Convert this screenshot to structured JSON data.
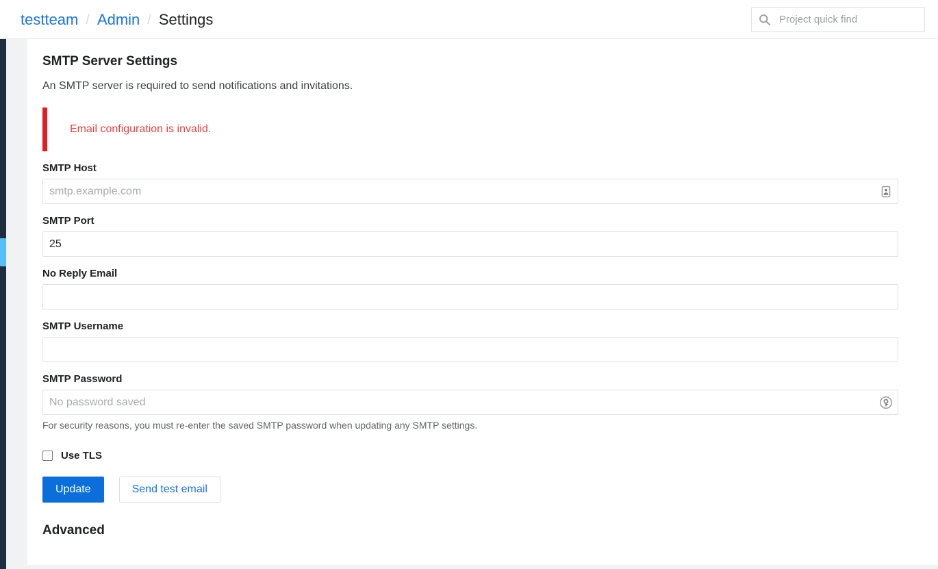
{
  "header": {
    "breadcrumb": {
      "items": [
        {
          "label": "testteam",
          "type": "link"
        },
        {
          "label": "Admin",
          "type": "link"
        },
        {
          "label": "Settings",
          "type": "current"
        }
      ],
      "separator": "/"
    },
    "search": {
      "icon": "search-icon",
      "placeholder": "Project quick find",
      "value": ""
    }
  },
  "sidebar": {
    "collapsed": true,
    "rail_color": "#1d2e3f",
    "active_indicator_color": "#57befc"
  },
  "main": {
    "section_title": "SMTP Server Settings",
    "section_description": "An SMTP server is required to send notifications and invitations.",
    "alert": {
      "message": "Email configuration is invalid.",
      "type": "error",
      "accent_color": "#e51c23",
      "text_color": "#e8423f"
    },
    "fields": [
      {
        "key": "smtp_host",
        "label": "SMTP Host",
        "value": "",
        "placeholder": "smtp.example.com",
        "icon": "contact-card-icon",
        "help": ""
      },
      {
        "key": "smtp_port",
        "label": "SMTP Port",
        "value": "25",
        "placeholder": "",
        "icon": "",
        "help": ""
      },
      {
        "key": "no_reply_email",
        "label": "No Reply Email",
        "value": "",
        "placeholder": "",
        "icon": "",
        "help": ""
      },
      {
        "key": "smtp_username",
        "label": "SMTP Username",
        "value": "",
        "placeholder": "",
        "icon": "",
        "help": ""
      },
      {
        "key": "smtp_password",
        "label": "SMTP Password",
        "value": "",
        "placeholder": "No password saved",
        "icon": "key-icon",
        "help": "For security reasons, you must re-enter the saved SMTP password when updating any SMTP settings."
      }
    ],
    "tls": {
      "label": "Use TLS",
      "checked": false
    },
    "buttons": {
      "update_label": "Update",
      "update_color": "#0b6fdb",
      "test_email_label": "Send test email",
      "test_email_color": "#1a73e8"
    },
    "advanced_title": "Advanced"
  }
}
